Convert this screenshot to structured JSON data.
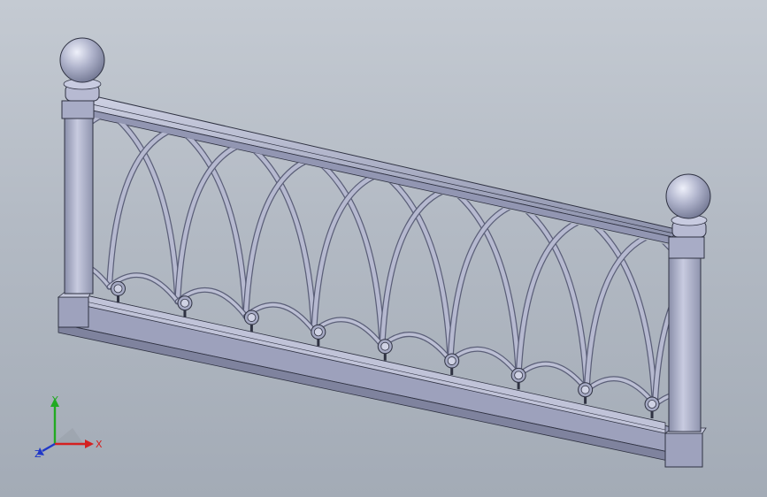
{
  "viewport": {
    "background_top": "#c4cad2",
    "background_bottom": "#a3abb6",
    "model_color": "#a6aac4",
    "model_shadow": "#7c819c",
    "model_highlight": "#d4d7e6",
    "edge_color": "#2f3242"
  },
  "triad": {
    "x_label": "X",
    "y_label": "Y",
    "z_label": "Z",
    "x_color": "#d42020",
    "y_color": "#22aa22",
    "z_color": "#2038c8"
  }
}
